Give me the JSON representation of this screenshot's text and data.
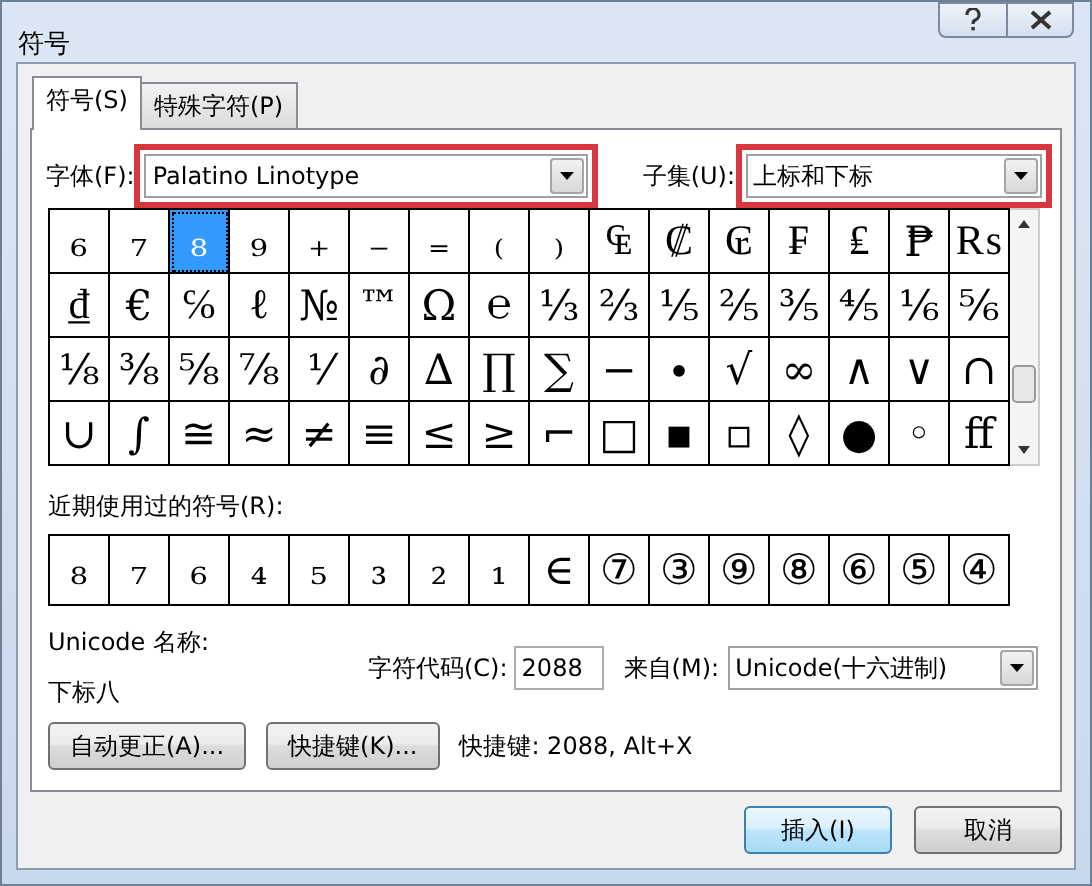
{
  "window": {
    "title": "符号"
  },
  "tabs": [
    {
      "label": "符号(S)",
      "selected": true
    },
    {
      "label": "特殊字符(P)",
      "selected": false
    }
  ],
  "font": {
    "label": "字体(F):",
    "value": "Palatino Linotype",
    "highlighted": true
  },
  "subset": {
    "label": "子集(U):",
    "value": "上标和下标",
    "highlighted": true
  },
  "symbols": [
    [
      {
        "char": "₆",
        "selected": false
      },
      {
        "char": "₇",
        "selected": false
      },
      {
        "char": "₈",
        "selected": true
      },
      {
        "char": "₉",
        "selected": false
      },
      {
        "char": "₊",
        "selected": false
      },
      {
        "char": "₋",
        "selected": false
      },
      {
        "char": "₌",
        "selected": false
      },
      {
        "char": "₍",
        "selected": false
      },
      {
        "char": "₎",
        "selected": false
      },
      {
        "char": "₠",
        "selected": false
      },
      {
        "char": "₡",
        "selected": false
      },
      {
        "char": "₢",
        "selected": false
      },
      {
        "char": "₣",
        "selected": false
      },
      {
        "char": "₤",
        "selected": false
      },
      {
        "char": "₱",
        "selected": false
      },
      {
        "char": "₨",
        "selected": false
      }
    ],
    [
      {
        "char": "₫",
        "selected": false
      },
      {
        "char": "€",
        "selected": false
      },
      {
        "char": "℅",
        "selected": false
      },
      {
        "char": "ℓ",
        "selected": false
      },
      {
        "char": "№",
        "selected": false
      },
      {
        "char": "™",
        "selected": false
      },
      {
        "char": "Ω",
        "selected": false
      },
      {
        "char": "℮",
        "selected": false
      },
      {
        "char": "⅓",
        "selected": false
      },
      {
        "char": "⅔",
        "selected": false
      },
      {
        "char": "⅕",
        "selected": false
      },
      {
        "char": "⅖",
        "selected": false
      },
      {
        "char": "⅗",
        "selected": false
      },
      {
        "char": "⅘",
        "selected": false
      },
      {
        "char": "⅙",
        "selected": false
      },
      {
        "char": "⅚",
        "selected": false
      }
    ],
    [
      {
        "char": "⅛",
        "selected": false
      },
      {
        "char": "⅜",
        "selected": false
      },
      {
        "char": "⅝",
        "selected": false
      },
      {
        "char": "⅞",
        "selected": false
      },
      {
        "char": "⅟",
        "selected": false
      },
      {
        "char": "∂",
        "selected": false
      },
      {
        "char": "∆",
        "selected": false
      },
      {
        "char": "∏",
        "selected": false
      },
      {
        "char": "∑",
        "selected": false
      },
      {
        "char": "−",
        "selected": false
      },
      {
        "char": "∙",
        "selected": false
      },
      {
        "char": "√",
        "selected": false
      },
      {
        "char": "∞",
        "selected": false
      },
      {
        "char": "∧",
        "selected": false
      },
      {
        "char": "∨",
        "selected": false
      },
      {
        "char": "∩",
        "selected": false
      }
    ],
    [
      {
        "char": "∪",
        "selected": false
      },
      {
        "char": "∫",
        "selected": false
      },
      {
        "char": "≅",
        "selected": false
      },
      {
        "char": "≈",
        "selected": false
      },
      {
        "char": "≠",
        "selected": false
      },
      {
        "char": "≡",
        "selected": false
      },
      {
        "char": "≤",
        "selected": false
      },
      {
        "char": "≥",
        "selected": false
      },
      {
        "char": "⌐",
        "selected": false
      },
      {
        "char": "□",
        "selected": false
      },
      {
        "char": "▪",
        "selected": false
      },
      {
        "char": "▫",
        "selected": false
      },
      {
        "char": "◊",
        "selected": false
      },
      {
        "char": "●",
        "selected": false
      },
      {
        "char": "◦",
        "selected": false
      },
      {
        "char": "ﬀ",
        "selected": false
      }
    ]
  ],
  "recent": {
    "label": "近期使用过的符号(R):",
    "symbols": [
      "₈",
      "₇",
      "₆",
      "₄",
      "₅",
      "₃",
      "₂",
      "₁",
      "∈",
      "⑦",
      "③",
      "⑨",
      "⑧",
      "⑥",
      "⑤",
      "④"
    ]
  },
  "unicode_name": {
    "label": "Unicode 名称:",
    "value": "下标八"
  },
  "char_code": {
    "label": "字符代码(C):",
    "value": "2088"
  },
  "from": {
    "label": "来自(M):",
    "value": "Unicode(十六进制)"
  },
  "action_buttons": [
    "自动更正(A)...",
    "快捷键(K)..."
  ],
  "shortcut_info": "快捷键: 2088, Alt+X",
  "footer_buttons": [
    {
      "label": "插入(I)",
      "default": true
    },
    {
      "label": "取消",
      "default": false
    }
  ]
}
